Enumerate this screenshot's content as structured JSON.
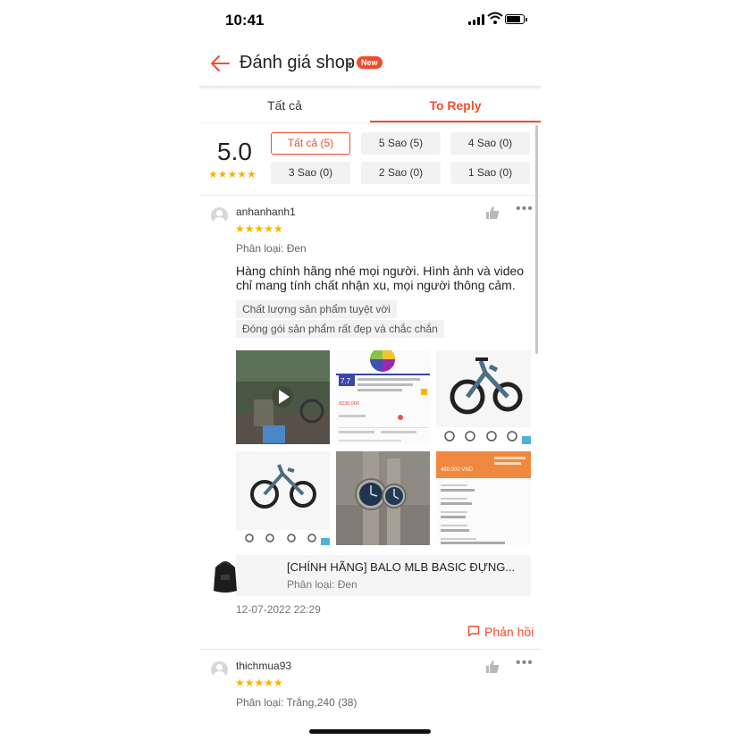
{
  "status_bar": {
    "time": "10:41"
  },
  "header": {
    "title": "Đánh giá shop",
    "badge": "New"
  },
  "tabs": [
    {
      "label": "Tất cả",
      "active": false
    },
    {
      "label": "To Reply",
      "active": true
    }
  ],
  "summary": {
    "score": "5.0",
    "stars": "★★★★★",
    "filters": [
      {
        "label": "Tất cả (5)",
        "active": true
      },
      {
        "label": "5 Sao (5)",
        "active": false
      },
      {
        "label": "4 Sao (0)",
        "active": false
      },
      {
        "label": "3 Sao (0)",
        "active": false
      },
      {
        "label": "2 Sao (0)",
        "active": false
      },
      {
        "label": "1 Sao (0)",
        "active": false
      }
    ]
  },
  "reviews": [
    {
      "username": "anhanhanh1",
      "stars": "★★★★★",
      "variant": "Phân loại: Đen",
      "comment": "Hàng chính hãng nhé mọi người. Hình ảnh và video chỉ mang tính chất nhận xu, mọi người thông cảm.",
      "tags": [
        "Chất lượng sản phẩm tuyệt vời",
        "Đóng gói sản phẩm rất đẹp và chắc chắn"
      ],
      "media": {
        "m2_badge": "7.7",
        "m2_price": "đ238.000",
        "m6_price": "450.000 VND"
      },
      "product": {
        "name": "[CHÍNH HÃNG] BALO MLB BASIC ĐỰNG...",
        "variant": "Phân loại: Đen"
      },
      "date": "12-07-2022 22:29",
      "reply_label": "Phản hồi"
    },
    {
      "username": "thichmua93",
      "stars": "★★★★★",
      "variant": "Phân loại: Trắng,240 (38)"
    }
  ],
  "colors": {
    "accent": "#ee4d2d",
    "star": "#f7b500"
  },
  "icons": [
    "back-arrow-icon",
    "dropdown-caret-icon",
    "thumbs-up-icon",
    "more-icon",
    "play-icon",
    "chat-reply-icon",
    "avatar-icon"
  ]
}
